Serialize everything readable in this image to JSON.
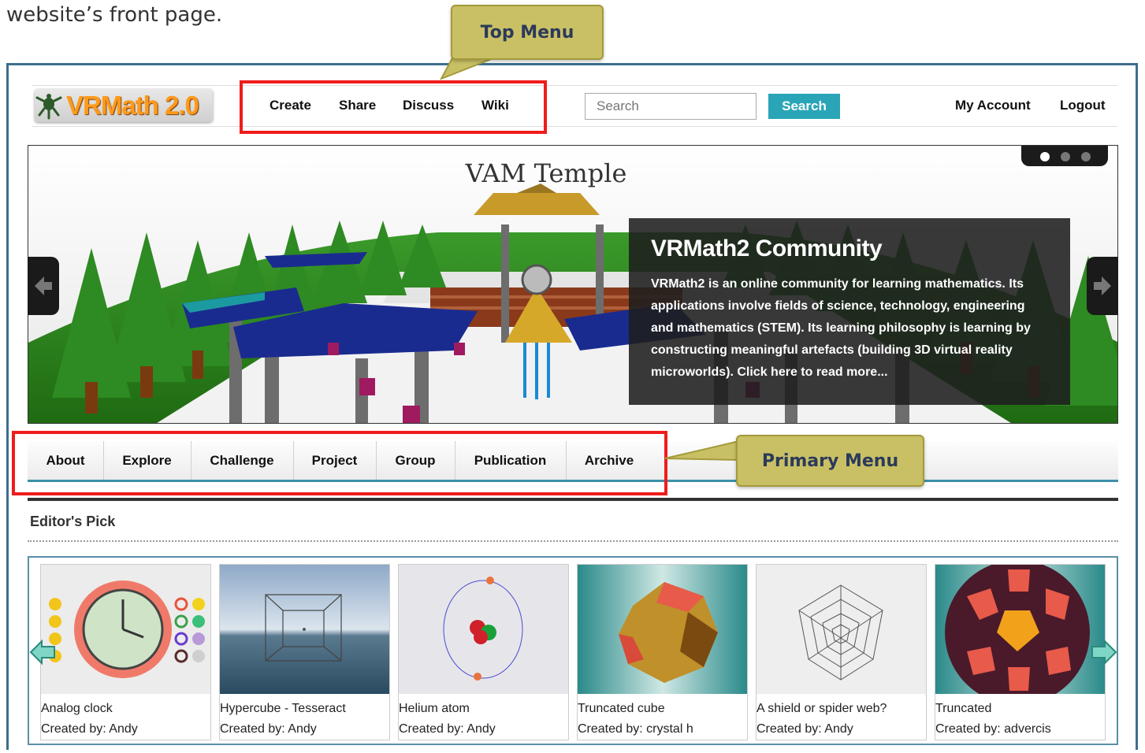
{
  "intro_text": "website’s front page.",
  "callouts": {
    "top_menu": "Top Menu",
    "primary_menu": "Primary Menu"
  },
  "header": {
    "logo_text": "VRMath 2.0",
    "nav": [
      "Create",
      "Share",
      "Discuss",
      "Wiki"
    ],
    "search": {
      "placeholder": "Search",
      "button_label": "Search"
    },
    "account": [
      "My Account",
      "Logout"
    ]
  },
  "slider": {
    "scene_title": "VAM Temple",
    "caption_title": "VRMath2 Community",
    "caption_body": "VRMath2 is an online community for learning mathematics. Its applications involve fields of science, technology, engineering and mathematics (STEM). Its learning philosophy is learning by constructing meaningful artefacts (building 3D virtual reality microworlds). Click here to read more..."
  },
  "primary_nav": [
    "About",
    "Explore",
    "Challenge",
    "Project",
    "Group",
    "Publication",
    "Archive"
  ],
  "editors_pick": {
    "heading": "Editor's Pick",
    "cards": [
      {
        "title": "Analog clock",
        "author": "Created by: Andy"
      },
      {
        "title": "Hypercube - Tesseract",
        "author": "Created by: Andy"
      },
      {
        "title": "Helium atom",
        "author": "Created by: Andy"
      },
      {
        "title": "Truncated cube",
        "author": "Created by: crystal h"
      },
      {
        "title": "A shield or spider web?",
        "author": "Created by: Andy"
      },
      {
        "title": "Truncated",
        "author": "Created by: advercis"
      }
    ]
  },
  "colors": {
    "accent": "#2aa5b8",
    "frame": "#3d6e8f",
    "highlight": "#ef1c1c",
    "callout": "#c9c065"
  }
}
